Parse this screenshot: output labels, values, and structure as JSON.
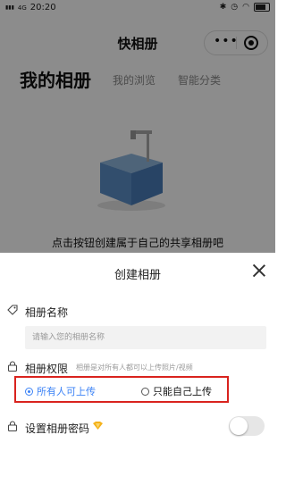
{
  "status_bar": {
    "carrier": "4G",
    "time": "20:20"
  },
  "nav": {
    "title": "快相册",
    "menu_icon": "more-dots-icon",
    "capsule_icon": "target-circle-icon"
  },
  "tabs": {
    "main": "我的相册",
    "items": [
      "我的浏览",
      "智能分类"
    ]
  },
  "empty_state": {
    "text": "点击按钮创建属于自己的共享相册吧",
    "illustration": "empty-box-icon"
  },
  "sheet": {
    "title": "创建相册",
    "close_icon": "close-icon",
    "name_label": "相册名称",
    "name_icon": "tag-icon",
    "name_placeholder": "请输入您的相册名称",
    "name_value": "",
    "permission_label": "相册权限",
    "permission_icon": "lock-icon",
    "permission_hint": "相册是对所有人都可以上传照片/视频",
    "options": [
      {
        "label": "所有人可上传",
        "checked": true
      },
      {
        "label": "只能自己上传",
        "checked": false
      }
    ],
    "password_label": "设置相册密码",
    "password_icon": "lock-icon",
    "vip_icon": "diamond-crown-icon",
    "password_enabled": false
  },
  "colors": {
    "accent": "#3b82f6",
    "highlight_border": "#d9231e",
    "vip": "#f5b21b"
  }
}
